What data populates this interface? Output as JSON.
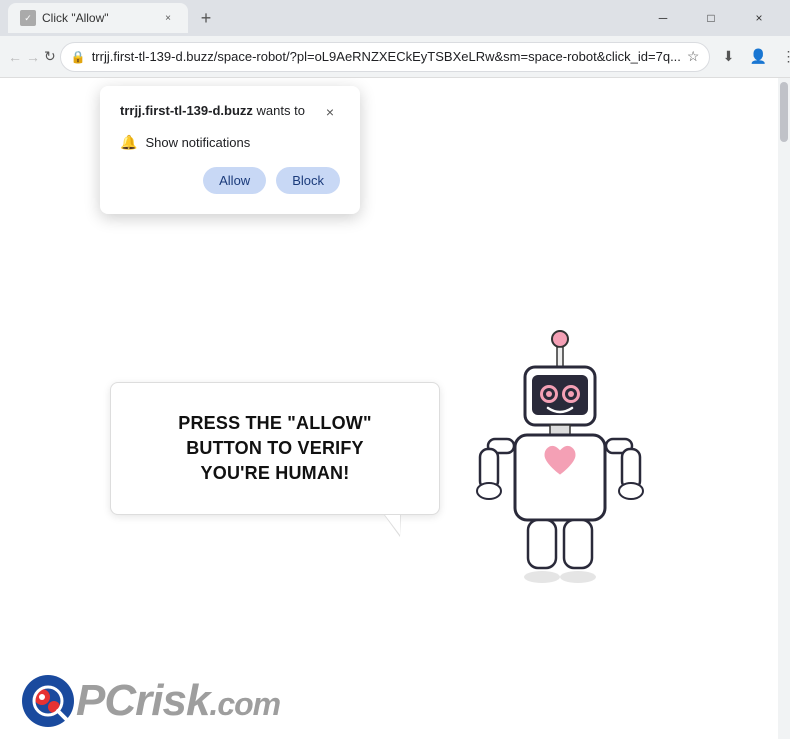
{
  "window": {
    "title": "Click \"Allow\"",
    "tab_close": "×",
    "new_tab": "+",
    "minimize": "─",
    "maximize": "□",
    "close": "×"
  },
  "nav": {
    "back": "←",
    "forward": "→",
    "refresh": "↻",
    "url": "trrjj.first-tl-139-d.buzz/space-robot/?pl=oL9AeRNZXECkEyTSBXeLRw&sm=space-robot&click_id=7q...",
    "star": "☆",
    "download": "⬇",
    "account": "👤",
    "menu": "⋮"
  },
  "popup": {
    "site": "trrjj.first-tl-139-d.buzz",
    "wants_to": " wants to",
    "close": "×",
    "notification_text": "Show notifications",
    "allow_label": "Allow",
    "block_label": "Block"
  },
  "page": {
    "main_text_line1": "PRESS THE \"ALLOW\" BUTTON TO VERIFY",
    "main_text_line2": "YOU'RE HUMAN!"
  },
  "logo": {
    "text_pc": "PC",
    "text_risk": "risk",
    "text_com": ".com"
  }
}
